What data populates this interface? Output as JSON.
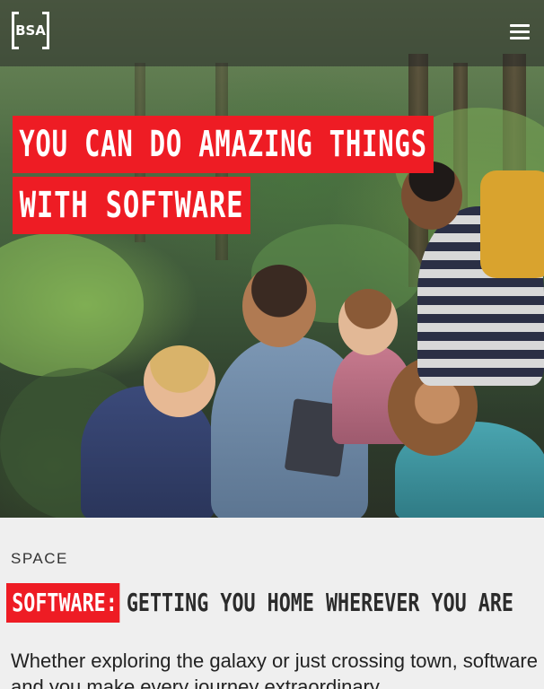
{
  "nav": {
    "logo_text": "BSA",
    "menu_icon": "hamburger-menu-icon"
  },
  "hero": {
    "headline_line1": "YOU CAN DO AMAZING THINGS",
    "headline_line2": "WITH SOFTWARE",
    "image_subject": "children-and-adult-in-forest-looking-at-tablet"
  },
  "article": {
    "category": "SPACE",
    "title_highlight": "SOFTWARE:",
    "title_rest": "GETTING YOU HOME WHEREVER YOU ARE",
    "body": "Whether exploring the galaxy or just crossing town, software and you make every journey extraordinary."
  },
  "colors": {
    "accent_red": "#ee1c24",
    "page_background": "#efefef",
    "text_dark": "#222222"
  }
}
